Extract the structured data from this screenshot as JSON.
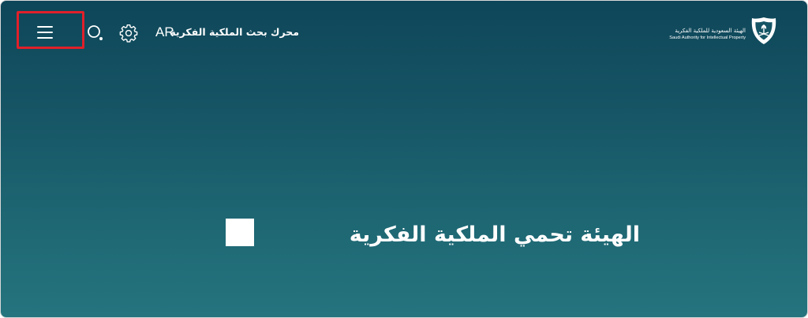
{
  "header": {
    "menu_icon": "hamburger-menu-icon",
    "search_icon": "search-icon",
    "settings_icon": "gear-icon",
    "language_label": "AR",
    "search_engine_label": "محرك بحث الملكية الفكرية"
  },
  "logo": {
    "name_ar": "الهيئة السعودية للملكية الفكرية",
    "name_en": "Saudi Authority for Intellectual Property",
    "emblem_icon": "saip-emblem-icon"
  },
  "hero": {
    "title": "الهيئة تحمي الملكية الفكرية"
  },
  "colors": {
    "background_top": "#0e4659",
    "background_bottom": "#25747e",
    "text": "#ffffff",
    "annotation": "#e0202a"
  }
}
